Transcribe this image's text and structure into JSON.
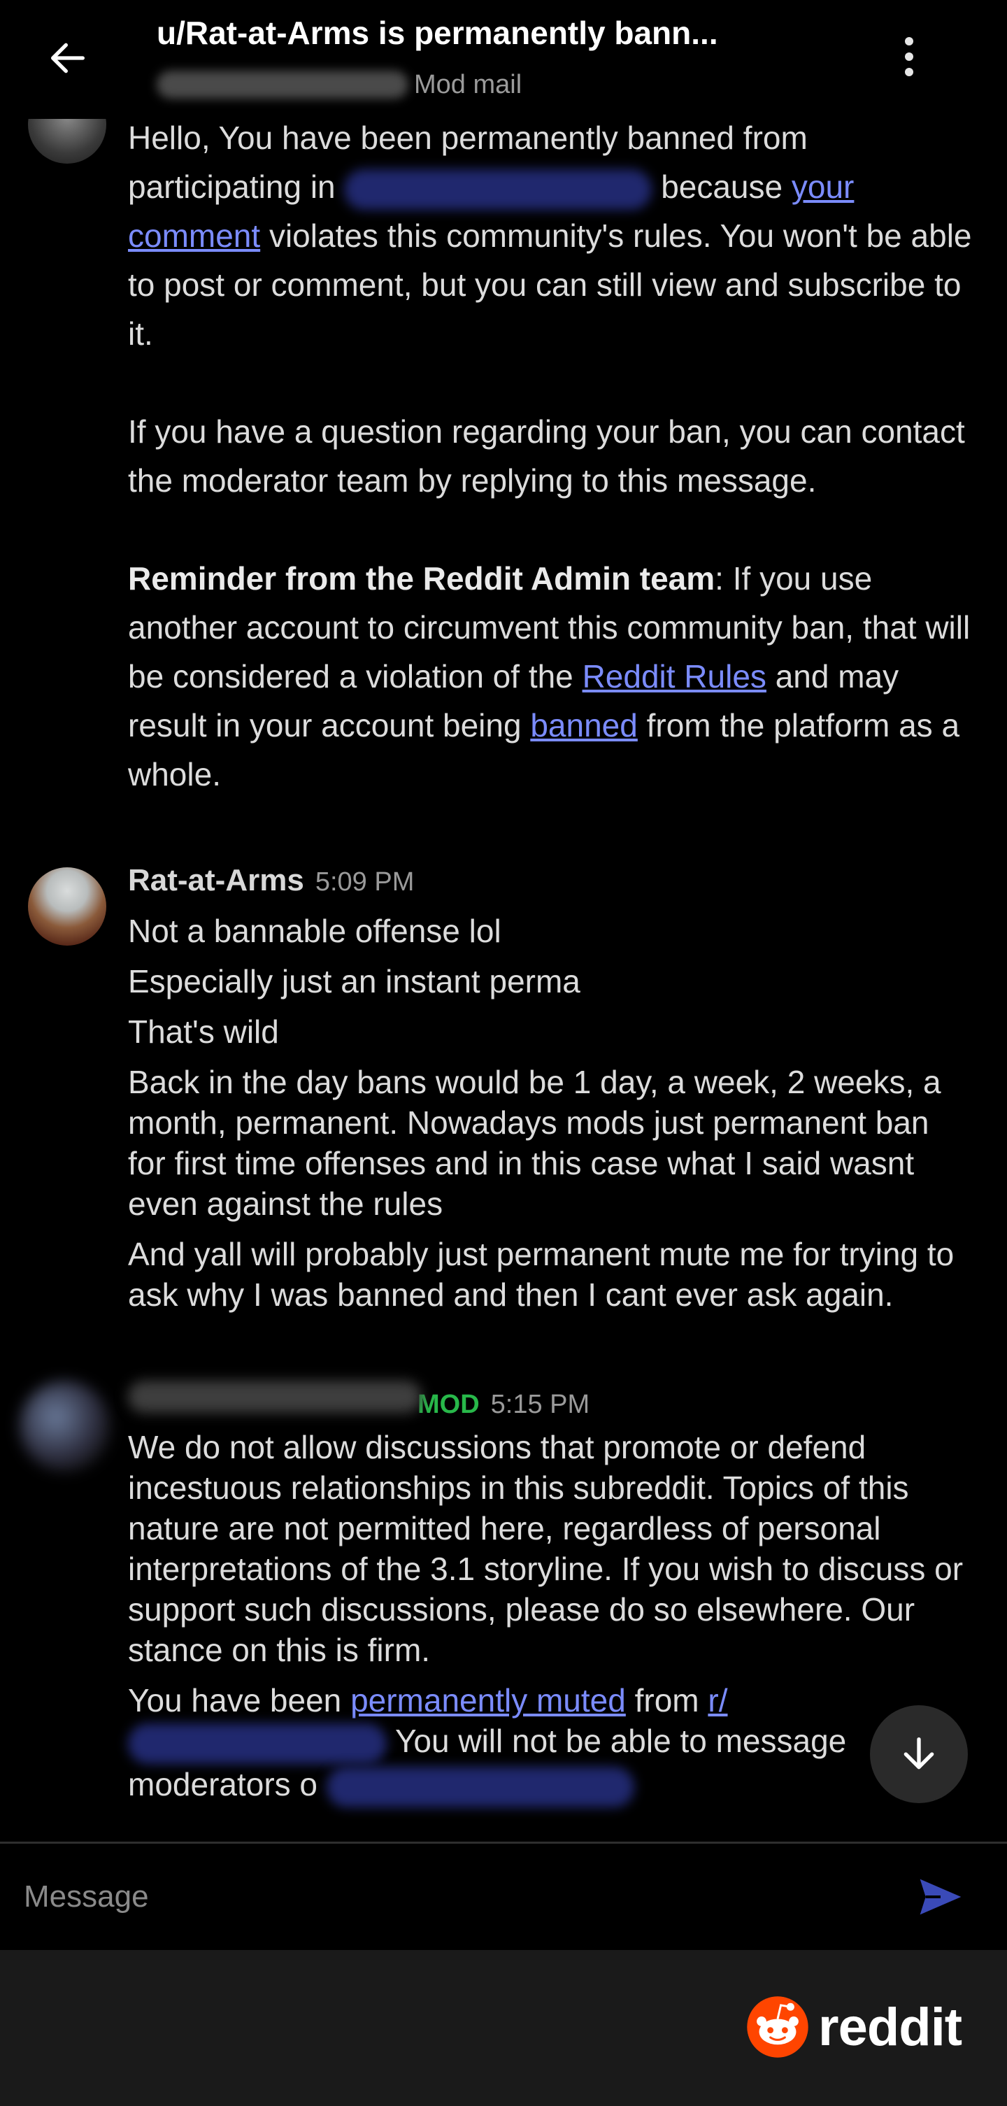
{
  "header": {
    "title": "u/Rat-at-Arms is permanently bann...",
    "subtitle": "Mod mail"
  },
  "messages": [
    {
      "paragraphs": {
        "p1_a": "Hello, You have been permanently banned from participating in",
        "p1_b": "because",
        "p1_link": "your comment",
        "p1_c": "violates this community's rules. You won't be able to post or comment, but you can still view and subscribe to it.",
        "p2": "If you have a question regarding your ban, you can contact the moderator team by replying to this message.",
        "p3_bold": "Reminder from the Reddit Admin team",
        "p3_a": ": If you use another account to circumvent this community ban, that will be considered a violation of the",
        "p3_link1": "Reddit Rules",
        "p3_b": "and may result in your account being",
        "p3_link2": "banned",
        "p3_c": "from the platform as a whole."
      }
    },
    {
      "author": "Rat-at-Arms",
      "time": "5:09 PM",
      "lines": [
        "Not a bannable offense lol",
        "Especially just an instant perma",
        "That's wild",
        "Back in the day bans would be 1 day, a week, 2 weeks, a month, permanent. Nowadays mods just permanent ban for first time offenses and in this case what I said wasnt even against the rules",
        "And yall will probably just permanent mute me for trying to ask why I was banned and then I cant ever ask again."
      ]
    },
    {
      "mod_tag": "MOD",
      "time": "5:15 PM",
      "body": "We do not allow discussions that promote or defend incestuous relationships in this subreddit. Topics of this nature are not permitted here, regardless of personal interpretations of the 3.1 storyline. If you wish to discuss or support such discussions, please do so elsewhere. Our stance on this is firm.",
      "system_a": "You have been",
      "system_link": "permanently muted",
      "system_b": "from",
      "system_link2": "r/",
      "system_c": "You will not be able to message",
      "system_d": "moderators o"
    }
  ],
  "composer": {
    "placeholder": "Message"
  },
  "footer": {
    "brand": "reddit"
  },
  "colors": {
    "link": "#7b8cff",
    "mod_tag": "#28b84a",
    "send": "#3a4ab8",
    "brand": "#ff4500"
  },
  "icons": [
    "back-arrow-icon",
    "more-vertical-icon",
    "arrow-down-icon",
    "send-icon",
    "reddit-snoo-icon"
  ]
}
